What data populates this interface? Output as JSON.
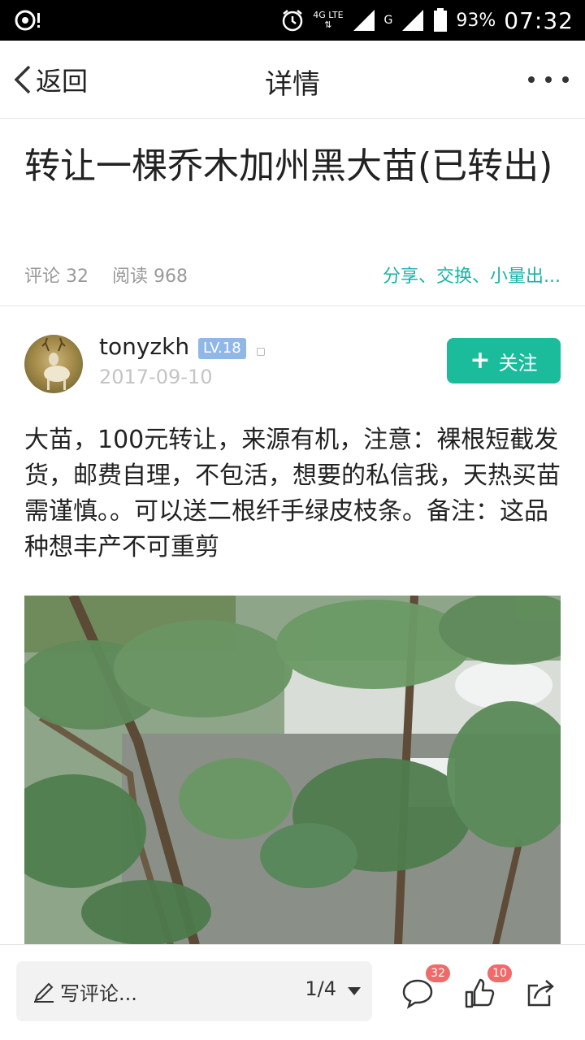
{
  "status_bar": {
    "network_top": "4G LTE",
    "sim2_label": "G",
    "battery": "93%",
    "time": "07:32"
  },
  "nav": {
    "back_label": "返回",
    "title": "详情"
  },
  "post": {
    "title": "转让一棵乔木加州黑大苗(已转出)",
    "comments_label": "评论 32",
    "reads_label": "阅读 968",
    "tags": "分享、交换、小量出...",
    "author": {
      "name": "tonyzkh",
      "level": "LV.18",
      "date": "2017-09-10"
    },
    "follow_label": "关注",
    "content": "大苗，100元转让，来源有机，注意：裸根短截发货，邮费自理，不包活，想要的私信我，天热买苗需谨慎。。可以送二根纤手绿皮枝条。备注：这品种想丰产不可重剪"
  },
  "bottom_bar": {
    "comment_placeholder": "写评论...",
    "page_indicator": "1/4",
    "comment_count": "32",
    "like_count": "10"
  },
  "colors": {
    "accent": "#1abc9c",
    "tag_text": "#17b3a6",
    "level_badge": "#8fb8e8",
    "count_badge": "#f06a6a"
  },
  "icons": [
    "alarm-icon",
    "signal-icon",
    "battery-icon",
    "chevron-left-icon",
    "more-icon",
    "plus-icon",
    "pen-icon",
    "dropdown-icon",
    "comment-icon",
    "thumbs-up-icon",
    "share-icon"
  ]
}
